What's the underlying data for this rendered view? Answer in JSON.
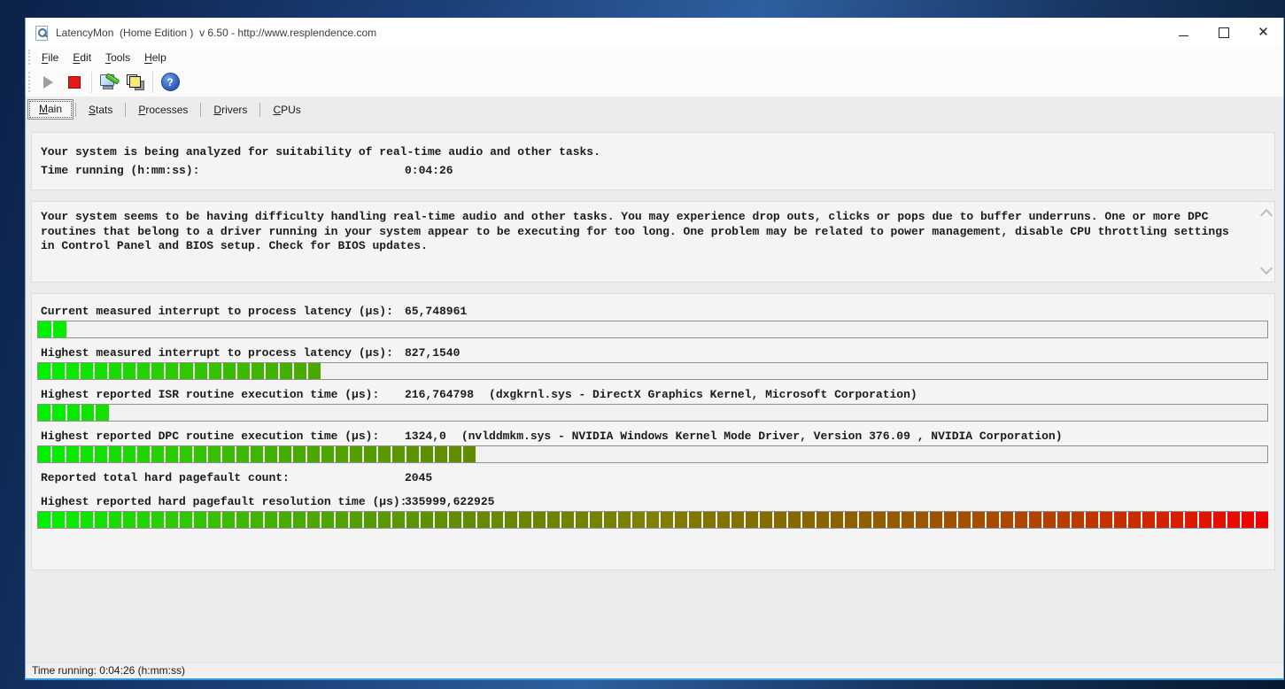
{
  "window": {
    "title": "LatencyMon  (Home Edition )  v 6.50 - http://www.resplendence.com"
  },
  "titlebar": {
    "icons": {
      "app": "document-magnifier-icon",
      "minimize": "minimize-icon",
      "maximize": "maximize-icon",
      "close": "close-icon"
    }
  },
  "menubar": {
    "items": [
      {
        "label": "File",
        "underline": 0
      },
      {
        "label": "Edit",
        "underline": 0
      },
      {
        "label": "Tools",
        "underline": 0
      },
      {
        "label": "Help",
        "underline": 0
      }
    ]
  },
  "toolbar": {
    "buttons": [
      {
        "name": "start-monitor-button",
        "icon": "play-icon",
        "enabled": false
      },
      {
        "name": "stop-monitor-button",
        "icon": "stop-icon",
        "enabled": true
      },
      {
        "name": "options-button",
        "icon": "monitor-tool-icon",
        "enabled": true
      },
      {
        "name": "copy-report-button",
        "icon": "layered-squares-icon",
        "enabled": true
      },
      {
        "name": "help-button",
        "icon": "help-icon",
        "enabled": true
      }
    ]
  },
  "tabs": [
    {
      "label": "Main",
      "underline": 0,
      "active": true
    },
    {
      "label": "Stats",
      "underline": 0,
      "active": false
    },
    {
      "label": "Processes",
      "underline": 0,
      "active": false
    },
    {
      "label": "Drivers",
      "underline": 0,
      "active": false
    },
    {
      "label": "CPUs",
      "underline": 0,
      "active": false
    }
  ],
  "analysis": {
    "status_line": "Your system is being analyzed for suitability of real-time audio and other tasks.",
    "time_label": "Time running (h:mm:ss):",
    "time_value": "0:04:26",
    "report_text": "Your system seems to be having difficulty handling real-time audio and other tasks. You may experience drop outs, clicks or pops due to buffer underruns. One or more DPC routines that belong to a driver running in your system appear to be executing for too long. One problem may be related to power management, disable CPU throttling settings in Control Panel and BIOS setup. Check for BIOS updates."
  },
  "monitor": {
    "bar_total_segments": 87,
    "bar_gradient": {
      "start_color": "#00f000",
      "mid_color": "#808000",
      "end_color": "#f00000"
    },
    "rows": [
      {
        "label": "Current measured interrupt to process latency (µs):",
        "value": "65,748961",
        "detail": "",
        "bar_filled": 2
      },
      {
        "label": "Highest measured interrupt to process latency (µs):",
        "value": "827,1540",
        "detail": "",
        "bar_filled": 20
      },
      {
        "label": "Highest reported ISR routine execution time (µs):",
        "value": "216,764798",
        "detail": "(dxgkrnl.sys - DirectX Graphics Kernel, Microsoft Corporation)",
        "bar_filled": 5
      },
      {
        "label": "Highest reported DPC routine execution time (µs):",
        "value": "1324,0",
        "detail": "(nvlddmkm.sys - NVIDIA Windows Kernel Mode Driver, Version 376.09 , NVIDIA Corporation)",
        "bar_filled": 31
      },
      {
        "label": "Reported total hard pagefault count:",
        "value": "2045",
        "detail": "",
        "bar_filled": null
      },
      {
        "label": "Highest reported hard pagefault resolution time (µs):",
        "value": "335999,622925",
        "detail": "",
        "bar_filled": 87
      }
    ]
  },
  "statusbar": {
    "text": "Time running: 0:04:26  (h:mm:ss)"
  }
}
